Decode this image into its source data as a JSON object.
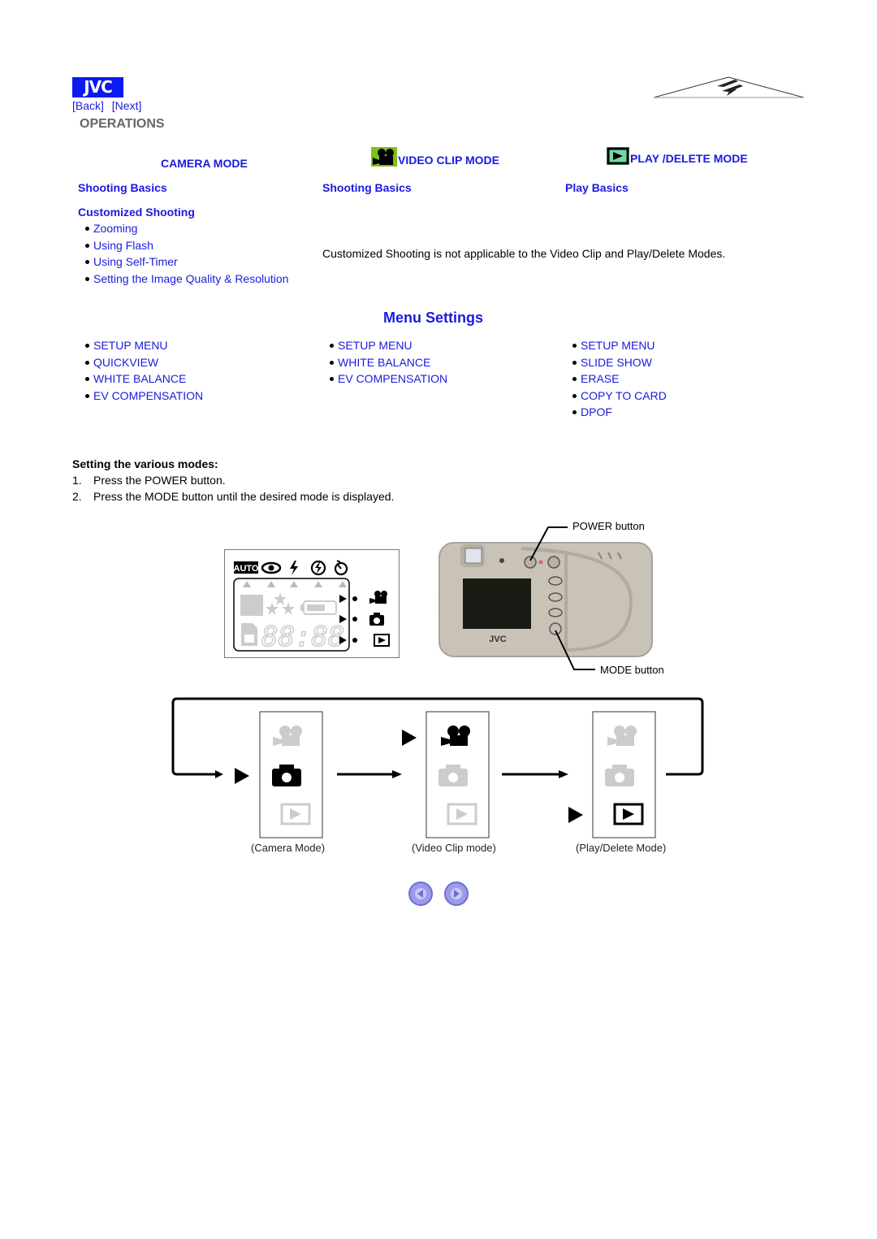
{
  "header": {
    "logo_text": "JVC",
    "back_label": "[Back]",
    "next_label": "[Next]",
    "section_title": "OPERATIONS",
    "brand_color": "#0d1af0",
    "link_color": "#1a1adf"
  },
  "modes": [
    {
      "title": "CAMERA MODE",
      "icon": "none",
      "basics": "Shooting Basics",
      "customized_title": "Customized Shooting",
      "customized_items": [
        "Zooming",
        "Using Flash",
        "Using Self-Timer",
        "Setting the Image Quality & Resolution"
      ]
    },
    {
      "title": "VIDEO CLIP MODE",
      "icon": "video-camera-icon",
      "basics": "Shooting Basics"
    },
    {
      "title": "PLAY /DELETE MODE",
      "icon": "play-icon",
      "basics": "Play Basics"
    }
  ],
  "customized_note": "Customized Shooting is not applicable to the Video Clip and Play/Delete Modes.",
  "menu_settings": {
    "title": "Menu Settings",
    "columns": [
      [
        "SETUP MENU",
        "QUICKVIEW",
        "WHITE BALANCE",
        "EV COMPENSATION"
      ],
      [
        "SETUP MENU",
        "WHITE BALANCE",
        "EV COMPENSATION"
      ],
      [
        "SETUP MENU",
        "SLIDE SHOW",
        "ERASE",
        "COPY TO CARD",
        "DPOF"
      ]
    ]
  },
  "instructions": {
    "heading": "Setting the various modes:",
    "steps": [
      {
        "num": "1.",
        "text": "Press the POWER button."
      },
      {
        "num": "2.",
        "text": "Press the MODE button until the desired mode is displayed."
      }
    ]
  },
  "lcd": {
    "top_icons": [
      "AUTO",
      "red-eye-icon",
      "flash-icon",
      "flash-off-icon",
      "self-timer-icon"
    ],
    "time_display": "88:88",
    "mode_icons": [
      "video-camera-icon",
      "camera-icon",
      "play-icon"
    ]
  },
  "camera_photo": {
    "power_label": "POWER button",
    "mode_label": "MODE button",
    "body_brand": "JVC"
  },
  "mode_cycle": {
    "captions": [
      "(Camera Mode)",
      "(Video Clip mode)",
      "(Play/Delete Mode)"
    ],
    "active": [
      "camera",
      "video",
      "play"
    ]
  },
  "bottom_nav": {
    "prev": "previous-page",
    "next": "next-page"
  }
}
